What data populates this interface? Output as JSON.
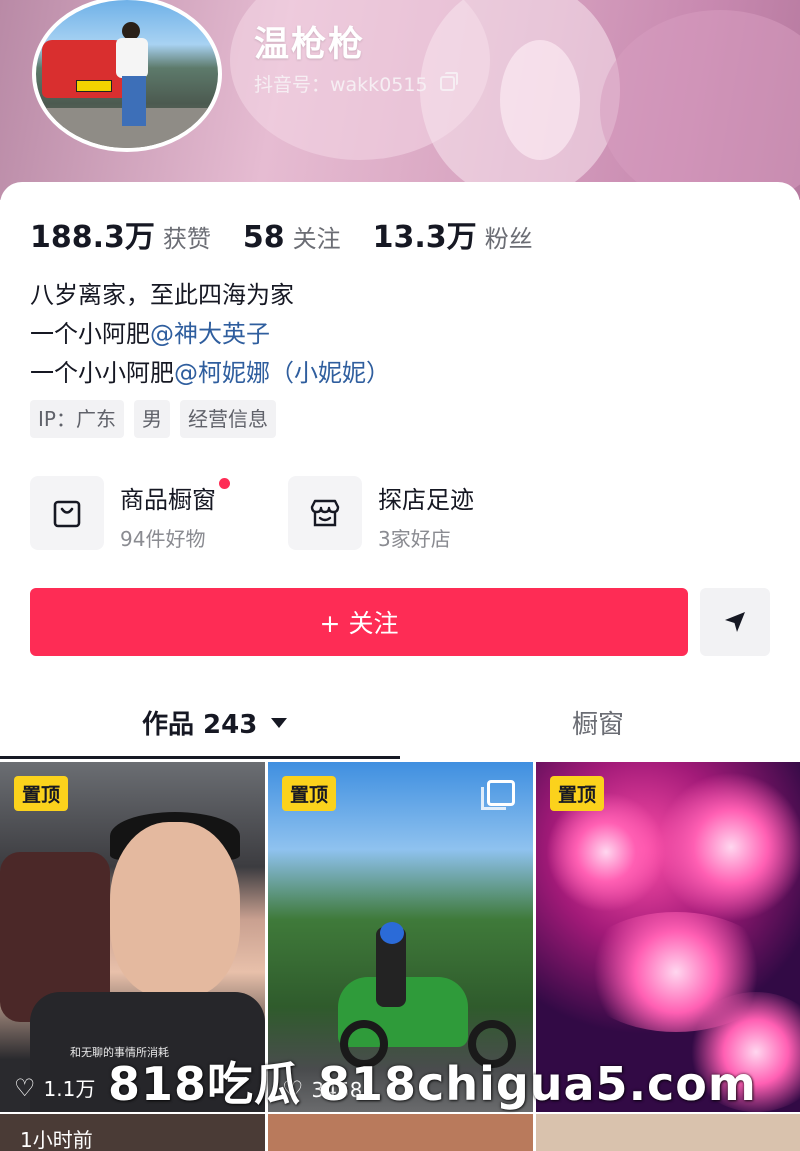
{
  "profile": {
    "username": "温枪枪",
    "douyin_id": "抖音号：wakk0515"
  },
  "stats": [
    {
      "value": "188.3万",
      "label": "获赞"
    },
    {
      "value": "58",
      "label": "关注"
    },
    {
      "value": "13.3万",
      "label": "粉丝"
    }
  ],
  "bio": {
    "line1": "八岁离家，至此四海为家",
    "line2_prefix": "一个小阿肥",
    "line2_mention": "@神大英子",
    "line3_prefix": "一个小小阿肥",
    "line3_mention": "@柯妮娜（小妮妮）"
  },
  "tags": [
    "IP：广东",
    "男",
    "经营信息"
  ],
  "entries": [
    {
      "title": "商品橱窗",
      "sub": "94件好物",
      "icon": "shopping-bag-icon"
    },
    {
      "title": "探店足迹",
      "sub": "3家好店",
      "icon": "store-icon"
    }
  ],
  "actions": {
    "follow_label": "+ 关注",
    "share_icon": "send-icon"
  },
  "tabs": {
    "works_label": "作品 243",
    "window_label": "橱窗"
  },
  "videos": [
    {
      "badge": "置顶",
      "caption": "和无聊的事情所消耗",
      "likes": "1.1万"
    },
    {
      "badge": "置顶",
      "likes": "3458"
    },
    {
      "badge": "置顶"
    }
  ],
  "row2": {
    "time_label": "1小时前"
  },
  "watermark": "818吃瓜   818chigua5.com",
  "colors": {
    "accent": "#fe2c55",
    "mention": "#2f5e9e",
    "pin_badge": "#fbd21c"
  }
}
